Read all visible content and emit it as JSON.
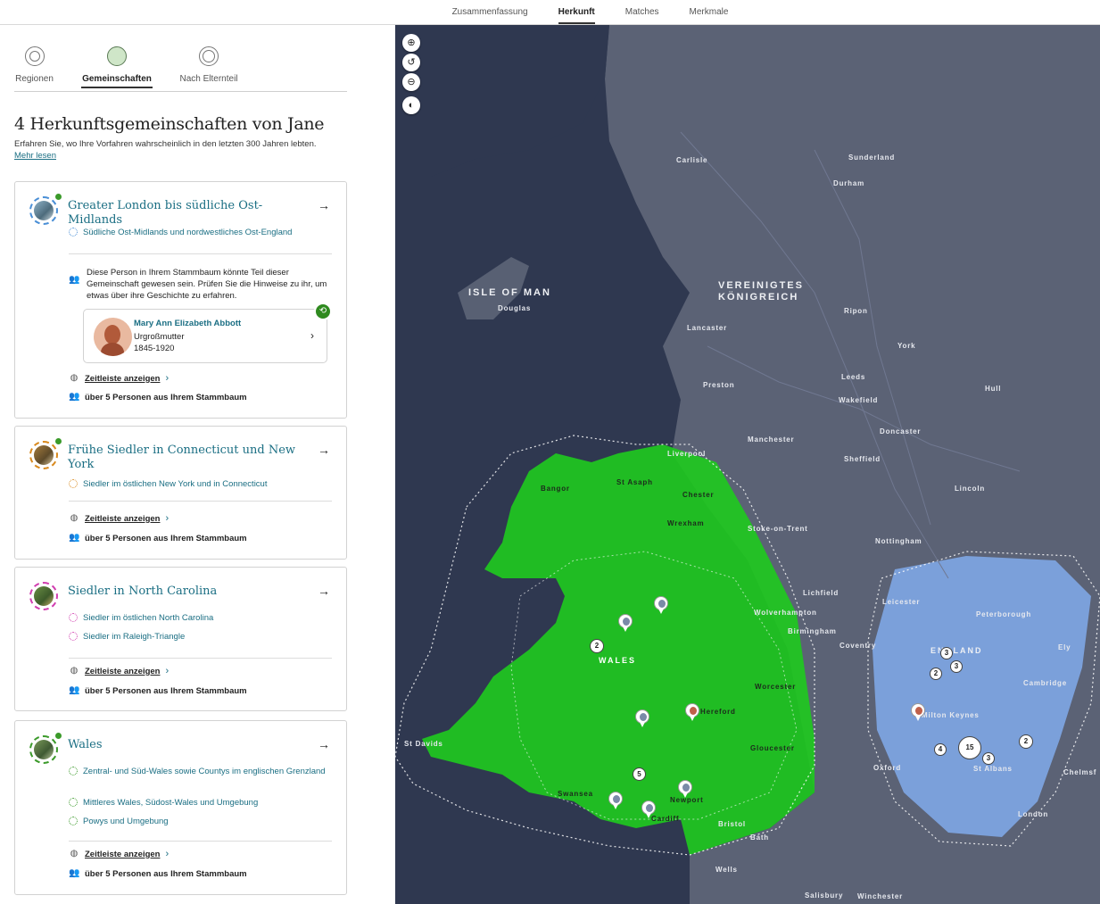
{
  "top_tabs": [
    "Zusammenfassung",
    "Herkunft",
    "Matches",
    "Merkmale"
  ],
  "sub_tabs": {
    "regions": "Regionen",
    "communities": "Gemeinschaften",
    "parent": "Nach Elternteil"
  },
  "header": {
    "title": "4 Herkunftsgemeinschaften von Jane",
    "intro": "Erfahren Sie, wo Ihre Vorfahren wahrscheinlich in den letzten 300 Jahren lebten.",
    "more": "Mehr lesen"
  },
  "common": {
    "timeline": "Zeitleiste anzeigen",
    "people": "über 5 Personen aus Ihrem Stammbaum"
  },
  "cards": [
    {
      "title": "Greater London bis südliche Ost-Midlands",
      "subs": [
        "Südliche Ost-Midlands und nordwestliches Ost-England"
      ],
      "note": "Diese Person in Ihrem Stammbaum könnte Teil dieser Gemeinschaft gewesen sein. Prüfen Sie die Hinweise zu ihr, um etwas über ihre Geschichte zu erfahren.",
      "person": {
        "name": "Mary Ann Elizabeth Abbott",
        "relation": "Urgroßmutter",
        "years": "1845-1920"
      },
      "color": "#4a8fd6"
    },
    {
      "title": "Frühe Siedler in Connecticut und New York",
      "subs": [
        "Siedler im östlichen New York und in Connecticut"
      ],
      "color": "#d98a1e"
    },
    {
      "title": "Siedler in North Carolina",
      "subs": [
        "Siedler im östlichen North Carolina",
        "Siedler im Raleigh-Triangle"
      ],
      "color": "#d13fb0"
    },
    {
      "title": "Wales",
      "subs": [
        "Zentral- und Süd-Wales sowie Countys im englischen Grenzland",
        "Mittleres Wales, Südost-Wales und Umgebung",
        "Powys und Umgebung"
      ],
      "color": "#3b9a2a"
    }
  ],
  "map": {
    "controls": [
      "zoom-in",
      "reset",
      "zoom-out",
      "layer"
    ],
    "labels": {
      "isle": "ISLE OF MAN",
      "douglas": "Douglas",
      "uk1": "VEREINIGTES",
      "uk2": "KÖNIGREICH",
      "carlisle": "Carlisle",
      "sunderland": "Sunderland",
      "durham": "Durham",
      "ripon": "Ripon",
      "lancaster": "Lancaster",
      "york": "York",
      "leeds": "Leeds",
      "wakefield": "Wakefield",
      "preston": "Preston",
      "hull": "Hull",
      "doncaster": "Doncaster",
      "manchester": "Manchester",
      "sheffield": "Sheffield",
      "liverpool": "Liverpool",
      "lincoln": "Lincoln",
      "bangor": "Bangor",
      "stasaph": "St Asaph",
      "chester": "Chester",
      "wrexham": "Wrexham",
      "stoke": "Stoke-on-Trent",
      "nottingham": "Nottingham",
      "lichfield": "Lichfield",
      "leicester": "Leicester",
      "peterborough": "Peterborough",
      "wolverhampton": "Wolverhampton",
      "birmingham": "Birmingham",
      "coventry": "Coventry",
      "england": "ENGLAND",
      "ely": "Ely",
      "wales": "WALES",
      "cambridge": "Cambridge",
      "worcester": "Worcester",
      "hereford": "Hereford",
      "miltonkeynes": "Milton Keynes",
      "stdavids": "St Davids",
      "gloucester": "Gloucester",
      "oxford": "Oxford",
      "stalbans": "St Albans",
      "chelmsford": "Chelmsf",
      "swansea": "Swansea",
      "newport": "Newport",
      "cardiff": "Cardiff",
      "bristol": "Bristol",
      "london": "London",
      "bath": "Bath",
      "wells": "Wells",
      "salisbury": "Salisbury",
      "winchester": "Winchester"
    },
    "clusters": [
      "2",
      "5",
      "3",
      "3",
      "2",
      "4",
      "15",
      "3",
      "2"
    ]
  },
  "colors": {
    "land": "#5b6275",
    "sea": "#2f3850",
    "wales_region": "#1fc81f",
    "london_region": "#7fa8e8",
    "accent": "#1a6e83"
  }
}
